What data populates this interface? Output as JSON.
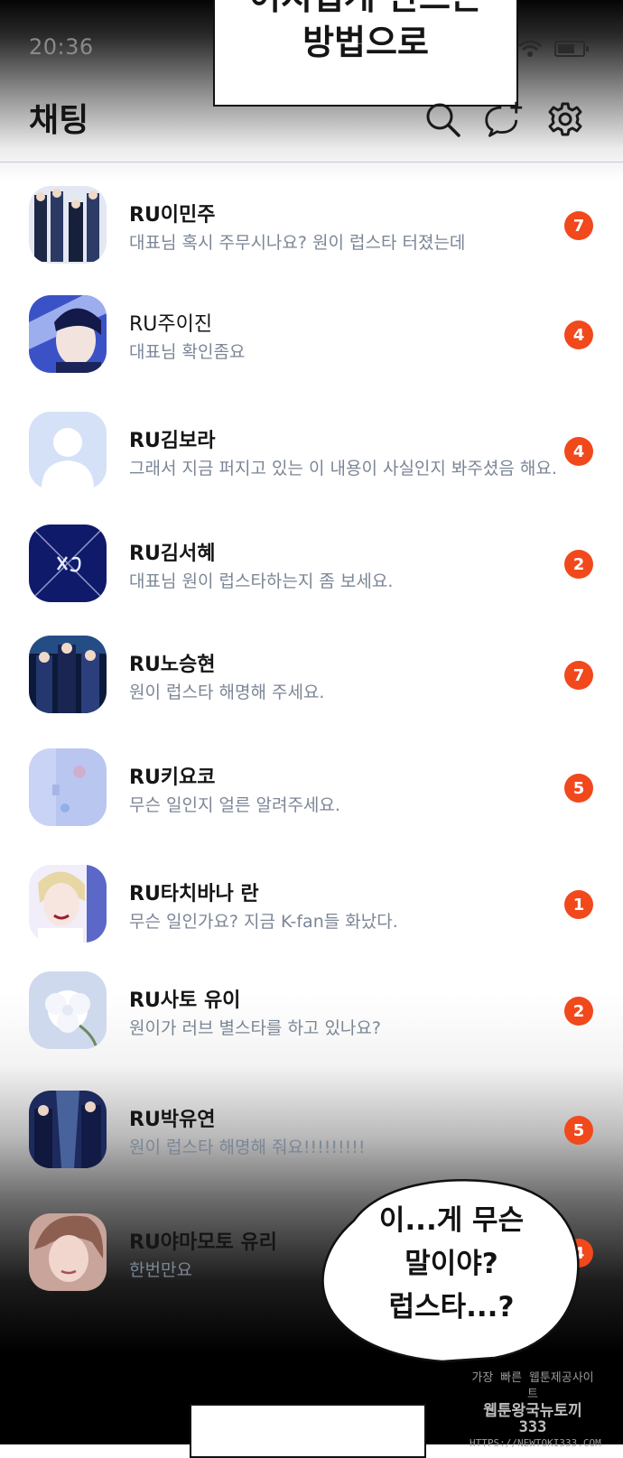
{
  "status_bar": {
    "time": "20:36"
  },
  "caption": {
    "line1": "어지럽게 만드는",
    "line2": "방법으로"
  },
  "header": {
    "title": "채팅"
  },
  "chats": [
    {
      "name": "RU이민주",
      "preview": "대표님 혹시 주무시나요? 원이 럽스타 터졌는데",
      "unread": "7",
      "avatar": "group-photo-avatar"
    },
    {
      "name": "RU주이진",
      "preview": "대표님 확인좀요",
      "unread": "4",
      "avatar": "portrait-blue-avatar"
    },
    {
      "name": "RU김보라",
      "preview": "그래서 지금 퍼지고 있는 이 내용이 사실인지 봐주셨음 해요.",
      "unread": "4",
      "avatar": "default-profile-avatar"
    },
    {
      "name": "RU김서혜",
      "preview": "대표님 원이 럽스타하는지 좀 보세요.",
      "unread": "2",
      "avatar": "logo-navy-avatar"
    },
    {
      "name": "RU노승현",
      "preview": "원이 럽스타 해명해 주세요.",
      "unread": "7",
      "avatar": "group-dark-avatar"
    },
    {
      "name": "RU키요코",
      "preview": "무슨 일인지 얼른 알려주세요.",
      "unread": "5",
      "avatar": "pastel-avatar"
    },
    {
      "name": "RU타치바나 란",
      "preview": "무슨 일인가요? 지금 K-fan들 화났다.",
      "unread": "1",
      "avatar": "portrait-avatar"
    },
    {
      "name": "RU사토 유이",
      "preview": "원이가 러브 별스타를 하고 있나요?",
      "unread": "2",
      "avatar": "flower-avatar"
    },
    {
      "name": "RU박유연",
      "preview": "원이 럽스타 해명해 줘요!!!!!!!!!",
      "unread": "5",
      "avatar": "group-stage-avatar"
    },
    {
      "name": "RU야마모토 유리",
      "preview": "한번만요",
      "unread": "4",
      "avatar": "portrait-warm-avatar"
    }
  ],
  "speech_bubble": {
    "line1": "이...게 무슨",
    "line2": "말이야?",
    "line3": "럽스타...?"
  },
  "watermark": {
    "line1": "가장 빠른 웹툰제공사이트",
    "line2": "웹툰왕국뉴토끼333",
    "line3": "HTTPS://NEWTOKI333.COM"
  },
  "colors": {
    "badge": "#f1481c",
    "preview_text": "#7b8696",
    "divider": "#c3cbd8"
  }
}
